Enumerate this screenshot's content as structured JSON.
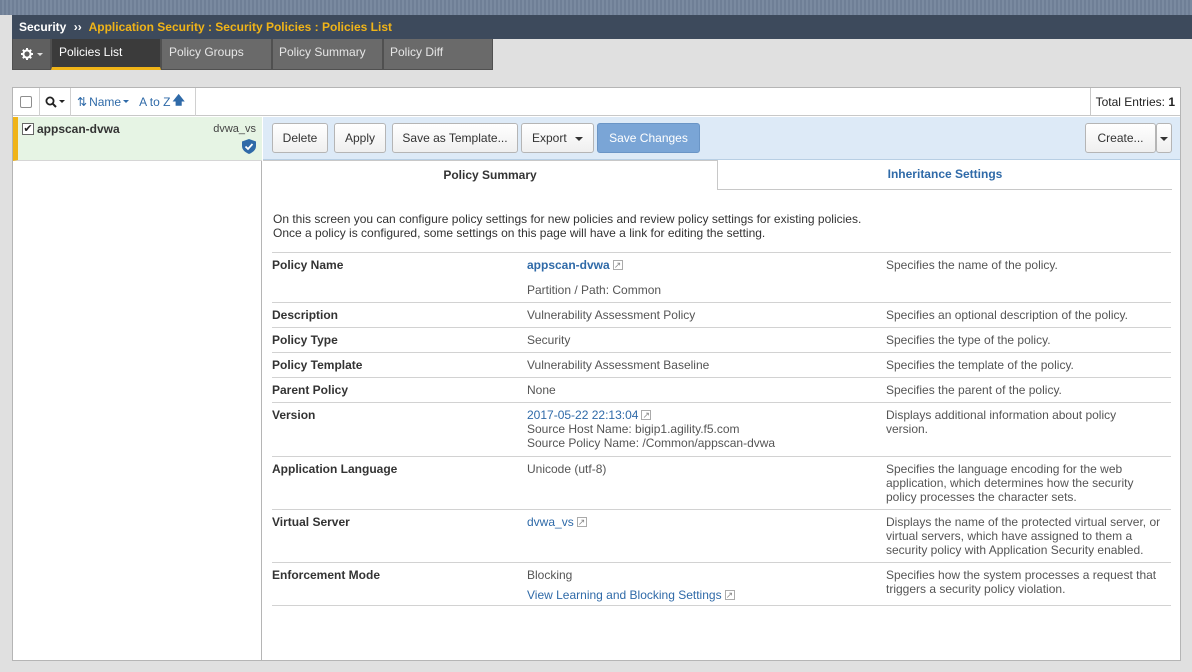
{
  "header": {
    "section": "Security",
    "separator": "››",
    "breadcrumb": "Application Security : Security Policies : Policies List"
  },
  "tabs": [
    {
      "label": "Policies List",
      "active": true
    },
    {
      "label": "Policy Groups",
      "active": false
    },
    {
      "label": "Policy Summary",
      "active": false
    },
    {
      "label": "Policy Diff",
      "active": false
    }
  ],
  "list_toolbar": {
    "sort_field": "Name",
    "sort_order": "A to Z",
    "total_label": "Total Entries:",
    "total_value": "1"
  },
  "policies": [
    {
      "name": "appscan-dvwa",
      "virtual_server": "dvwa_vs",
      "checked": true
    }
  ],
  "actions": {
    "delete": "Delete",
    "apply": "Apply",
    "save_template": "Save as Template...",
    "export": "Export",
    "save_changes": "Save Changes",
    "create": "Create..."
  },
  "subtabs": {
    "summary": "Policy Summary",
    "inheritance": "Inheritance Settings"
  },
  "intro": {
    "line1": "On this screen you can configure policy settings for new policies and review policy settings for existing policies.",
    "line2": "Once a policy is configured, some settings on this page will have a link for editing the setting."
  },
  "details": {
    "policy_name": {
      "label": "Policy Name",
      "value": "appscan-dvwa",
      "extra": "Partition / Path: Common",
      "desc": "Specifies the name of the policy."
    },
    "description": {
      "label": "Description",
      "value": "Vulnerability Assessment Policy",
      "desc": "Specifies an optional description of the policy."
    },
    "policy_type": {
      "label": "Policy Type",
      "value": "Security",
      "desc": "Specifies the type of the policy."
    },
    "policy_template": {
      "label": "Policy Template",
      "value": "Vulnerability Assessment Baseline",
      "desc": "Specifies the template of the policy."
    },
    "parent_policy": {
      "label": "Parent Policy",
      "value": "None",
      "desc": "Specifies the parent of the policy."
    },
    "version": {
      "label": "Version",
      "value": "2017-05-22 22:13:04",
      "host": "Source Host Name: bigip1.agility.f5.com",
      "source_policy": "Source Policy Name: /Common/appscan-dvwa",
      "desc_line1": "Displays additional information about policy",
      "desc_line2": "version."
    },
    "app_language": {
      "label": "Application Language",
      "value": "Unicode (utf-8)",
      "desc_line1": "Specifies the language encoding for the web",
      "desc_line2": "application, which determines how the security",
      "desc_line3": "policy processes the character sets."
    },
    "virtual_server": {
      "label": "Virtual Server",
      "value": "dvwa_vs",
      "desc_line1": "Displays the name of the protected virtual server, or",
      "desc_line2": "virtual servers, which have assigned to them a",
      "desc_line3": "security policy with Application Security enabled."
    },
    "enforcement": {
      "label": "Enforcement Mode",
      "value": "Blocking",
      "link": "View Learning and Blocking Settings",
      "desc_line1": "Specifies how the system processes a request that",
      "desc_line2": "triggers a security policy violation."
    }
  },
  "colors": {
    "accent": "#f0b418",
    "link": "#2f6aa8",
    "titlebar": "#3d4a5c",
    "selected_row": "#e6f4e4"
  }
}
